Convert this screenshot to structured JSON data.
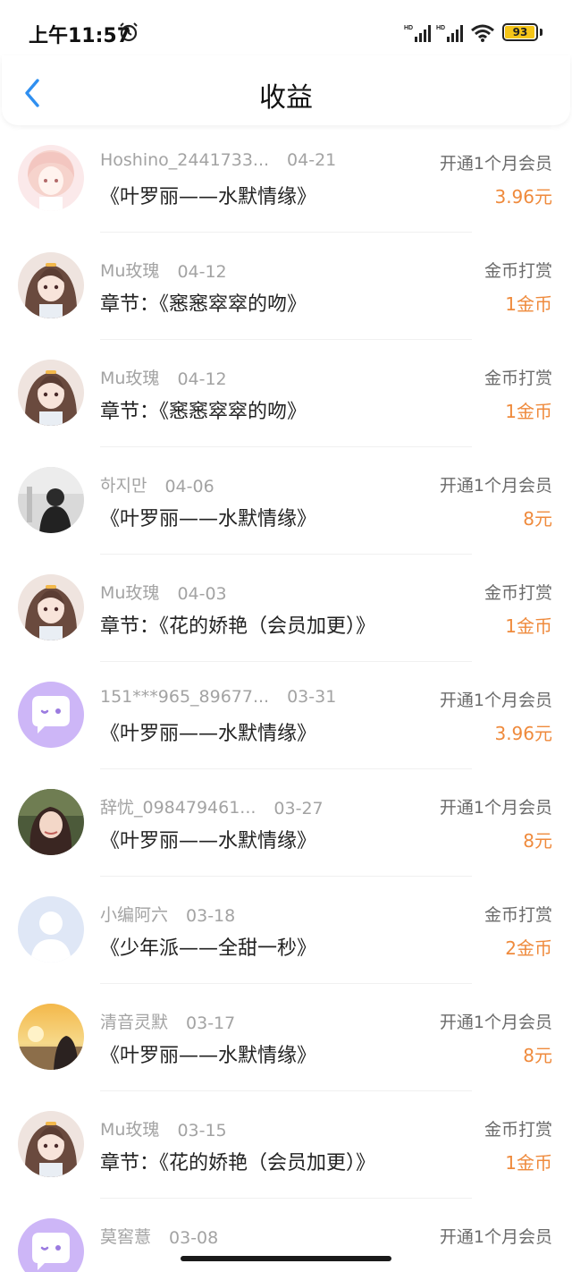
{
  "status_bar": {
    "time": "上午11:57",
    "battery": "93"
  },
  "header": {
    "title": "收益"
  },
  "records": [
    {
      "user": "Hoshino_2441733...",
      "date": "04-21",
      "type": "开通1个月会员",
      "work": "《叶罗丽——水默情缘》",
      "amount": "3.96元",
      "avatar": "anime-pink"
    },
    {
      "user": "Mu玫瑰",
      "date": "04-12",
      "type": "金币打赏",
      "work": "章节：《窸窸窣窣的吻》",
      "amount": "1金币",
      "avatar": "anime-brown"
    },
    {
      "user": "Mu玫瑰",
      "date": "04-12",
      "type": "金币打赏",
      "work": "章节：《窸窸窣窣的吻》",
      "amount": "1金币",
      "avatar": "anime-brown"
    },
    {
      "user": "하지만",
      "date": "04-06",
      "type": "开通1个月会员",
      "work": "《叶罗丽——水默情缘》",
      "amount": "8元",
      "avatar": "dark-photo"
    },
    {
      "user": "Mu玫瑰",
      "date": "04-03",
      "type": "金币打赏",
      "work": "章节：《花的娇艳（会员加更）》",
      "amount": "1金币",
      "avatar": "anime-brown"
    },
    {
      "user": "151***965_89677...",
      "date": "03-31",
      "type": "开通1个月会员",
      "work": "《叶罗丽——水默情缘》",
      "amount": "3.96元",
      "avatar": "default-purple"
    },
    {
      "user": "辞忧_098479461...",
      "date": "03-27",
      "type": "开通1个月会员",
      "work": "《叶罗丽——水默情缘》",
      "amount": "8元",
      "avatar": "girl-photo"
    },
    {
      "user": "小编阿六",
      "date": "03-18",
      "type": "金币打赏",
      "work": "《少年派——全甜一秒》",
      "amount": "2金币",
      "avatar": "default-blue"
    },
    {
      "user": "清音灵默",
      "date": "03-17",
      "type": "开通1个月会员",
      "work": "《叶罗丽——水默情缘》",
      "amount": "8元",
      "avatar": "sunset-photo"
    },
    {
      "user": "Mu玫瑰",
      "date": "03-15",
      "type": "金币打赏",
      "work": "章节：《花的娇艳（会员加更）》",
      "amount": "1金币",
      "avatar": "anime-brown"
    },
    {
      "user": "莫窖薏",
      "date": "03-08",
      "type": "开通1个月会员",
      "work": "",
      "amount": "",
      "avatar": "default-purple"
    }
  ]
}
